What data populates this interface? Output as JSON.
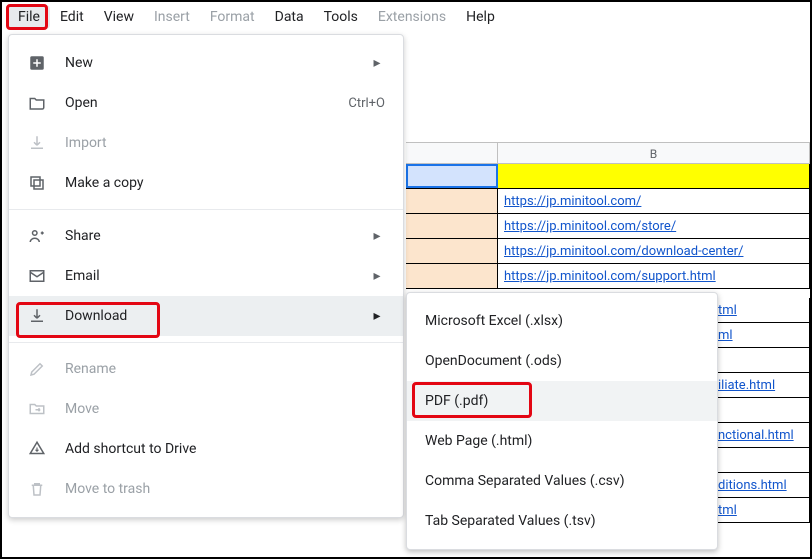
{
  "menubar": {
    "items": [
      {
        "label": "File",
        "disabled": false,
        "active": true
      },
      {
        "label": "Edit",
        "disabled": false
      },
      {
        "label": "View",
        "disabled": false
      },
      {
        "label": "Insert",
        "disabled": true
      },
      {
        "label": "Format",
        "disabled": true
      },
      {
        "label": "Data",
        "disabled": false
      },
      {
        "label": "Tools",
        "disabled": false
      },
      {
        "label": "Extensions",
        "disabled": true
      },
      {
        "label": "Help",
        "disabled": false
      }
    ]
  },
  "sheet": {
    "column_b_label": "B",
    "links": [
      "https://jp.minitool.com/",
      "https://jp.minitool.com/store/",
      "https://jp.minitool.com/download-center/",
      "https://jp.minitool.com/support.html"
    ],
    "partial_tails": [
      "tml",
      "ml",
      "iliate.html",
      "nctional.html",
      "ditions.html",
      "tml"
    ]
  },
  "file_menu": {
    "new": "New",
    "open": "Open",
    "open_shortcut": "Ctrl+O",
    "import": "Import",
    "make_copy": "Make a copy",
    "share": "Share",
    "email": "Email",
    "download": "Download",
    "rename": "Rename",
    "move": "Move",
    "add_shortcut": "Add shortcut to Drive",
    "trash": "Move to trash"
  },
  "download_menu": {
    "xlsx": "Microsoft Excel (.xlsx)",
    "ods": "OpenDocument (.ods)",
    "pdf": "PDF (.pdf)",
    "html": "Web Page (.html)",
    "csv": "Comma Separated Values (.csv)",
    "tsv": "Tab Separated Values (.tsv)"
  },
  "chevron": "▸"
}
